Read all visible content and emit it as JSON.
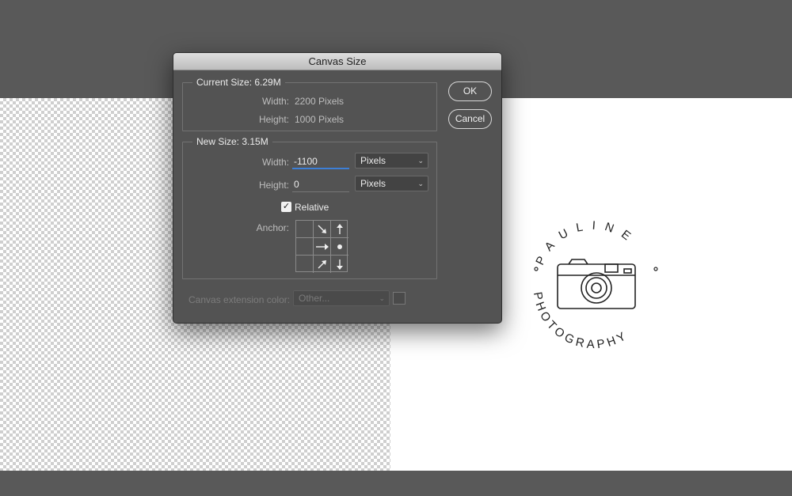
{
  "dialog": {
    "title": "Canvas Size",
    "current_size": {
      "title": "Current Size: 6.29M",
      "width_label": "Width:",
      "width_value": "2200 Pixels",
      "height_label": "Height:",
      "height_value": "1000 Pixels"
    },
    "new_size": {
      "title": "New Size: 3.15M",
      "width_label": "Width:",
      "width_value": "-1100",
      "width_unit": "Pixels",
      "height_label": "Height:",
      "height_value": "0",
      "height_unit": "Pixels",
      "relative_label": "Relative",
      "relative_checked": true,
      "anchor_label": "Anchor:",
      "anchor_position": "middle-right"
    },
    "extension_color_label": "Canvas extension color:",
    "extension_color_value": "Other...",
    "ok_label": "OK",
    "cancel_label": "Cancel"
  },
  "logo": {
    "top_text": "PAULINE",
    "bottom_text": "PHOTOGRAPHY"
  },
  "colors": {
    "workspace": "#595959",
    "dialog_bg": "#535353",
    "focus_accent": "#3d7fd6"
  }
}
